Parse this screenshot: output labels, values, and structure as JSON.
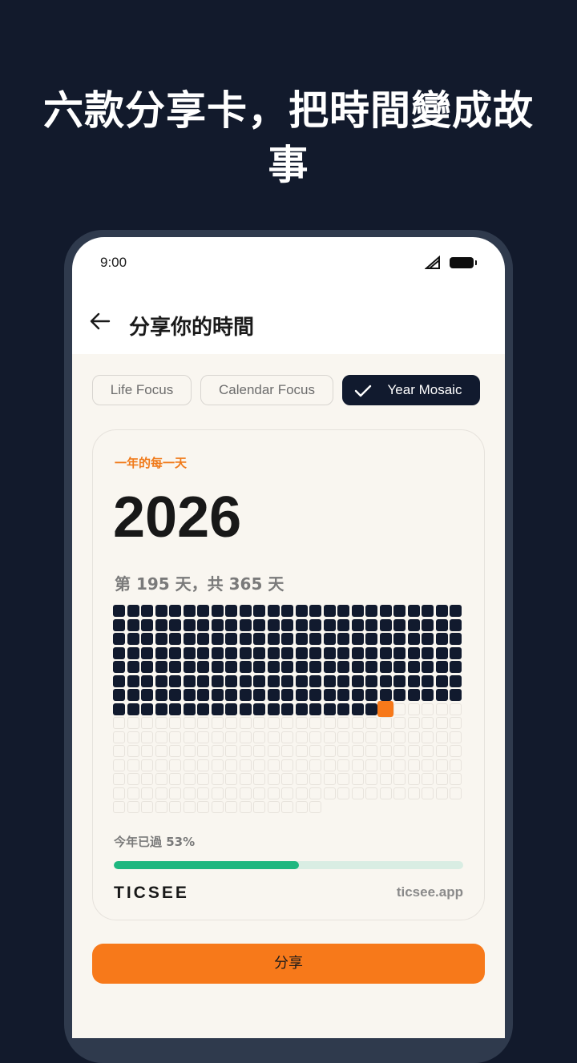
{
  "headline": "六款分享卡，把時間變成故事",
  "status_bar": {
    "time": "9:00"
  },
  "app_bar": {
    "title": "分享你的時間"
  },
  "chips": [
    {
      "label": "Life Focus",
      "selected": false
    },
    {
      "label": "Calendar Focus",
      "selected": false
    },
    {
      "label": "Year Mosaic",
      "selected": true
    }
  ],
  "card": {
    "label": "一年的每一天",
    "year": "2026",
    "day_summary": "第 195 天，共 365 天",
    "mosaic": {
      "total_days": 365,
      "days_passed": 195,
      "columns": 25
    },
    "progress_label": "今年已過 53%",
    "progress_fraction": 0.53,
    "brand": "TICSEE",
    "site": "ticsee.app"
  },
  "share_label": "分享",
  "colors": {
    "background": "#121a2c",
    "accent": "#f7791a",
    "past_cell": "#111a2e",
    "progress": "#1eb77f"
  }
}
